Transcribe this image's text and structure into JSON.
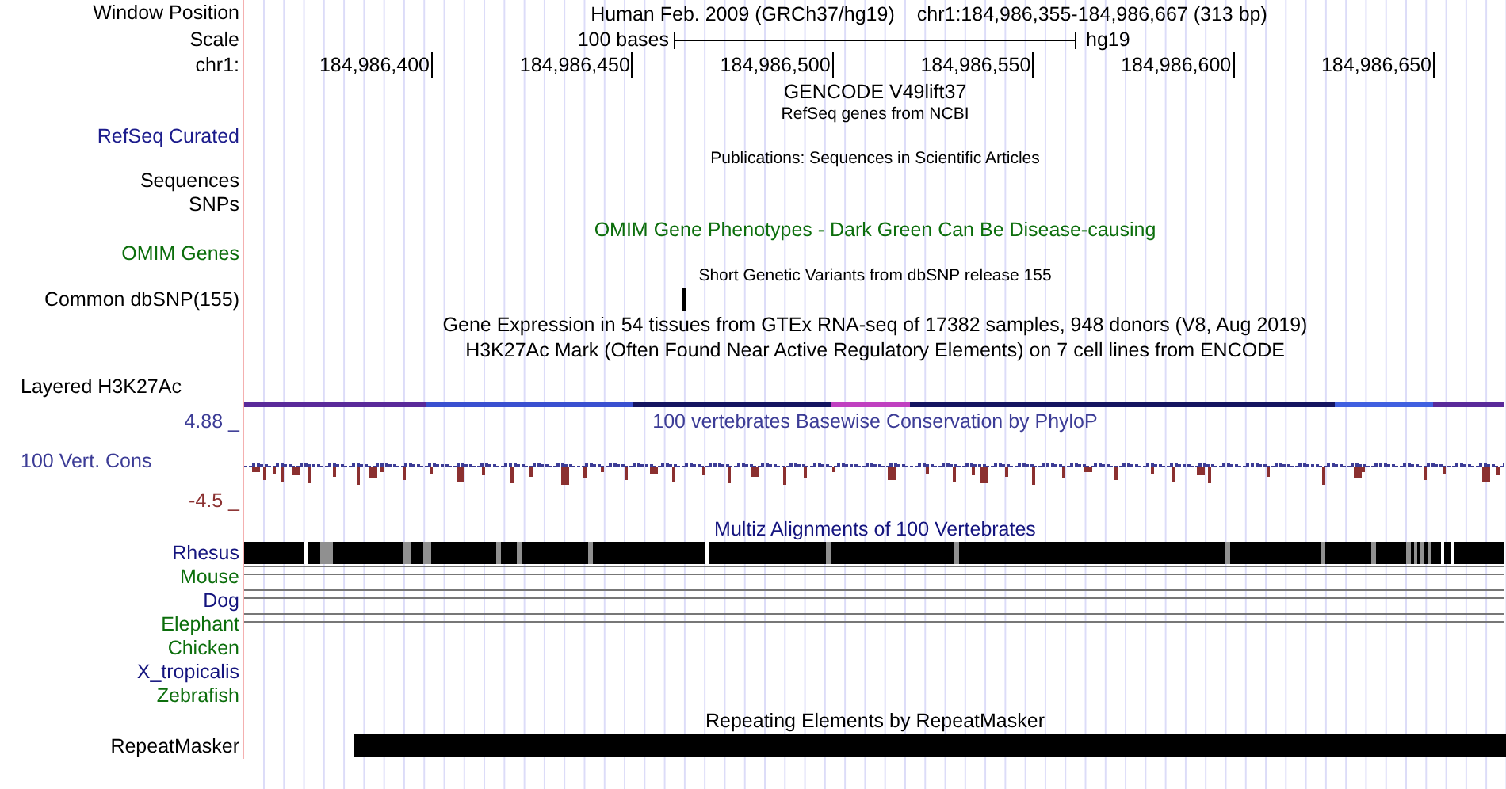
{
  "tracks": [
    {
      "kind": "position",
      "label": "Window Position",
      "title": "Human Feb. 2009 (GRCh37/hg19)",
      "position": "chr1:184,986,355-184,986,667 (313 bp)"
    },
    {
      "kind": "scale",
      "label": "Scale",
      "bar_label": "100 bases",
      "assembly": "hg19"
    },
    {
      "kind": "ruler",
      "label": "chr1:",
      "ticks": [
        "184,986,400",
        "184,986,450",
        "184,986,500",
        "184,986,550",
        "184,986,600",
        "184,986,650"
      ]
    },
    {
      "kind": "title",
      "title": "GENCODE V49lift37",
      "color": "#000000"
    },
    {
      "kind": "small",
      "title": "RefSeq genes from NCBI",
      "color": "#000000"
    },
    {
      "kind": "label",
      "label": "RefSeq Curated",
      "color": "#1c1c8c"
    },
    {
      "kind": "small",
      "title": "Publications: Sequences in Scientific Articles",
      "color": "#000000"
    },
    {
      "kind": "label",
      "label": "Sequences",
      "color": "#000000"
    },
    {
      "kind": "label",
      "label": "SNPs",
      "color": "#000000"
    },
    {
      "kind": "title",
      "title": "OMIM Gene Phenotypes - Dark Green Can Be Disease-causing",
      "color": "#0c6e0c"
    },
    {
      "kind": "label",
      "label": "OMIM Genes",
      "color": "#0c6e0c"
    },
    {
      "kind": "small",
      "title": "Short Genetic Variants from dbSNP release 155",
      "color": "#000000"
    },
    {
      "kind": "snp",
      "label": "Common dbSNP(155)"
    },
    {
      "kind": "title",
      "title": "Gene Expression in 54 tissues from GTEx RNA-seq of 17382 samples, 948 donors (V8, Aug 2019)",
      "color": "#000000"
    },
    {
      "kind": "title",
      "title": "H3K27Ac Mark (Often Found Near Active Regulatory Elements) on 7 cell lines from ENCODE",
      "color": "#000000"
    },
    {
      "kind": "composite",
      "label": "Layered H3K27Ac"
    },
    {
      "kind": "wiggle",
      "title": "100 vertebrates Basewise Conservation by PhyloP",
      "max_label": "4.88 _",
      "label": "100 Vert. Cons",
      "min_label": "-4.5 _"
    },
    {
      "kind": "title",
      "title": "Multiz Alignments of 100 Vertebrates",
      "color": "#14147e"
    },
    {
      "kind": "species_block",
      "label": "Rhesus",
      "color": "#14147e"
    },
    {
      "kind": "species_lines",
      "label": "Mouse",
      "color": "#0c6e0c"
    },
    {
      "kind": "species_lines",
      "label": "Dog",
      "color": "#14147e"
    },
    {
      "kind": "species_lines",
      "label": "Elephant",
      "color": "#0c6e0c"
    },
    {
      "kind": "species_empty",
      "label": "Chicken",
      "color": "#0c6e0c"
    },
    {
      "kind": "species_empty",
      "label": "X_tropicalis",
      "color": "#14147e"
    },
    {
      "kind": "species_empty",
      "label": "Zebrafish",
      "color": "#0c6e0c"
    },
    {
      "kind": "title",
      "title": "Repeating Elements by RepeatMasker",
      "color": "#000000"
    },
    {
      "kind": "repeat",
      "label": "RepeatMasker"
    }
  ]
}
